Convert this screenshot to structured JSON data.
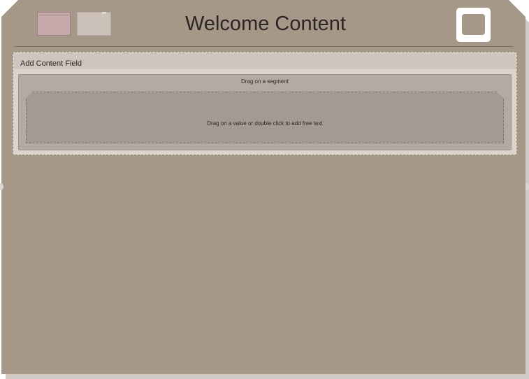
{
  "header": {
    "title": "Welcome Content",
    "thumbnails": [
      {
        "icon": "slide-thumbnail-icon",
        "color": "#c6aaab"
      },
      {
        "icon": "slide-thumbnail-icon",
        "color": "#cbc1b8"
      }
    ],
    "frame_button": {
      "icon": "frame-icon"
    }
  },
  "content_field": {
    "label": "Add Content Field",
    "segment_hint": "Drag on a segment",
    "value_hint": "Drag on a value or double click to add free text"
  },
  "colors": {
    "card_background": "#a69889",
    "field_background": "#dcd4cc",
    "segment_background": "#b3aaa3",
    "value_background": "#a29a94",
    "field_border": "#8d9275"
  }
}
